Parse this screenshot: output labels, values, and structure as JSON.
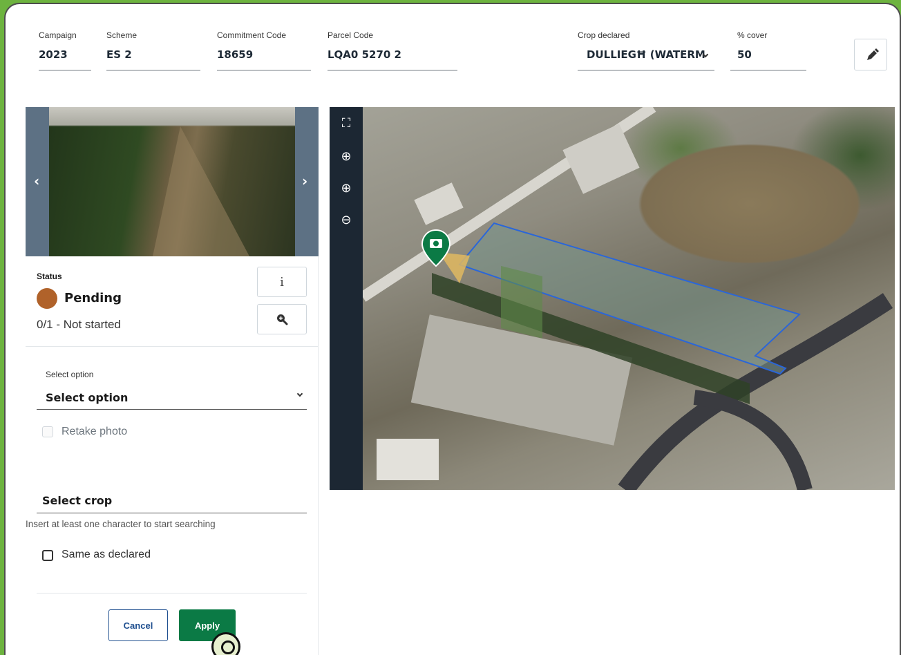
{
  "header": {
    "campaign": {
      "label": "Campaign",
      "value": "2023"
    },
    "scheme": {
      "label": "Scheme",
      "value": "ES 2"
    },
    "commitment": {
      "label": "Commitment Code",
      "value": "18659"
    },
    "parcel": {
      "label": "Parcel Code",
      "value": "LQA0 5270 2"
    },
    "crop_declared": {
      "label": "Crop declared",
      "value": "DULLIEGĦ (WATERM"
    },
    "cover": {
      "label": "% cover",
      "value": "50"
    },
    "edit_icon": "pencil-icon"
  },
  "photo": {
    "prev_icon": "chevron-left-icon",
    "next_icon": "chevron-right-icon"
  },
  "status": {
    "label": "Status",
    "value": "Pending",
    "color": "#b0622a",
    "progress": "0/1 - Not started",
    "info_button": "i",
    "zoom_icon": "zoom-in-icon"
  },
  "form": {
    "select_label": "Select option",
    "select_value": "Select option",
    "retake_label": "Retake photo",
    "crop_label": "Select crop",
    "crop_hint": "Insert at least one character to start searching",
    "same_label": "Same as declared",
    "cancel_label": "Cancel",
    "apply_label": "Apply"
  },
  "map": {
    "tools": [
      "fullscreen-icon",
      "locate-icon",
      "zoom-in-icon",
      "zoom-out-icon"
    ],
    "marker_icon": "camera-icon",
    "accent": "#0b7a45",
    "parcel_outline": "#2a66d9"
  }
}
